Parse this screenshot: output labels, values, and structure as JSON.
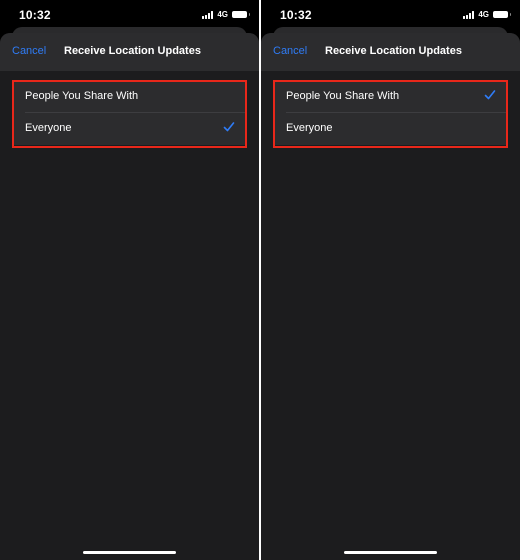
{
  "screens": [
    {
      "status": {
        "time": "10:32",
        "network": "4G"
      },
      "nav": {
        "cancel_label": "Cancel",
        "title": "Receive Location Updates"
      },
      "options": [
        {
          "label": "People You Share With",
          "selected": false
        },
        {
          "label": "Everyone",
          "selected": true
        }
      ]
    },
    {
      "status": {
        "time": "10:32",
        "network": "4G"
      },
      "nav": {
        "cancel_label": "Cancel",
        "title": "Receive Location Updates"
      },
      "options": [
        {
          "label": "People You Share With",
          "selected": true
        },
        {
          "label": "Everyone",
          "selected": false
        }
      ]
    }
  ],
  "colors": {
    "accent": "#2f7cf6",
    "highlight_border": "#e8271a",
    "sheet_bg": "#1c1c1e",
    "group_bg": "#2c2c2e"
  }
}
